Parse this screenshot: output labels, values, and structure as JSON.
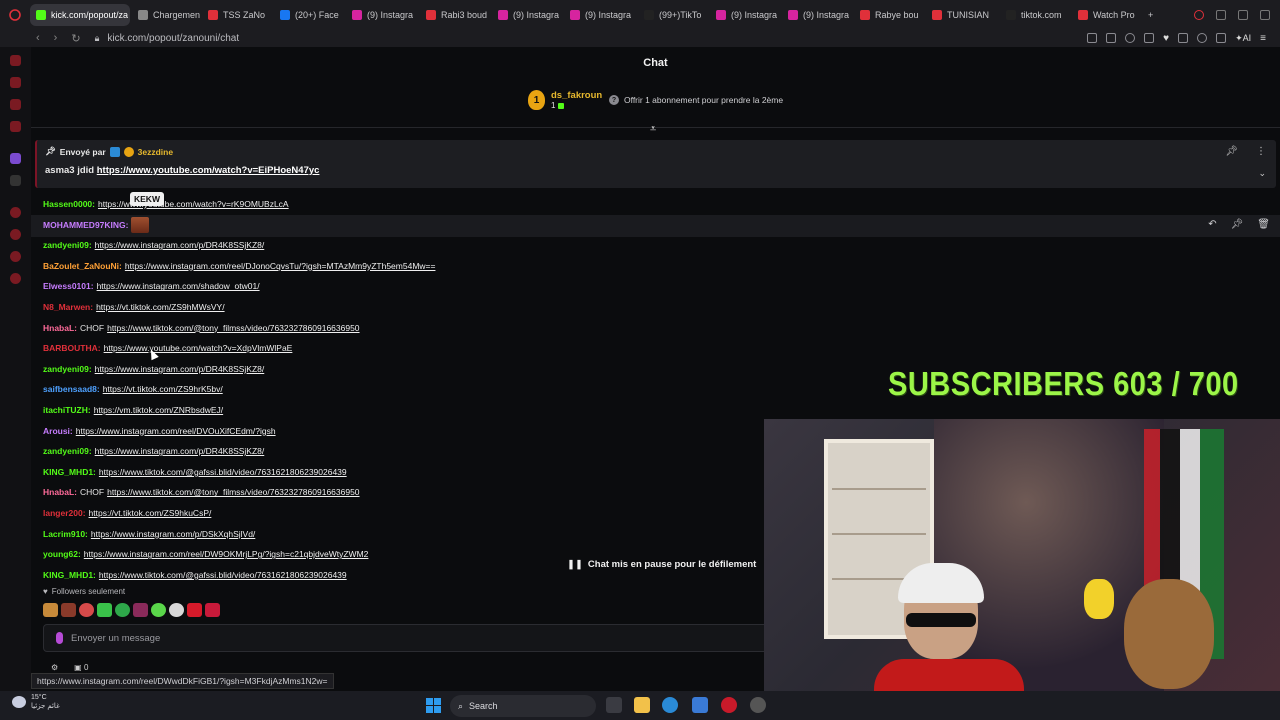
{
  "browser": {
    "tabs": [
      {
        "label": "kick.com/popout/za",
        "color": "#53fc18",
        "active": true
      },
      {
        "label": "Chargemen",
        "color": "#888888"
      },
      {
        "label": "TSS ZaNo",
        "color": "#e0303a"
      },
      {
        "label": "(20+) Face",
        "color": "#1877f2"
      },
      {
        "label": "(9) Instagra",
        "color": "#d6249f"
      },
      {
        "label": "Rabi3 boud",
        "color": "#e0303a"
      },
      {
        "label": "(9) Instagra",
        "color": "#d6249f"
      },
      {
        "label": "(9) Instagra",
        "color": "#d6249f"
      },
      {
        "label": "(99+)TikTo",
        "color": "#222222"
      },
      {
        "label": "(9) Instagra",
        "color": "#d6249f"
      },
      {
        "label": "(9) Instagra",
        "color": "#d6249f"
      },
      {
        "label": "Rabye bou",
        "color": "#e0303a"
      },
      {
        "label": "TUNISIAN",
        "color": "#e0303a"
      },
      {
        "label": "tiktok.com",
        "color": "#222222"
      },
      {
        "label": "Watch Pro",
        "color": "#e0303a"
      }
    ],
    "new_tab": "+",
    "address": "kick.com/popout/zanouni/chat",
    "status_url": "https://www.instagram.com/reel/DWwdDkFiGB1/?igsh=M3FkdjAzMms1N2w="
  },
  "chat": {
    "title": "Chat",
    "leaderboard": {
      "rank": "1",
      "name": "ds_fakroun",
      "count": "1",
      "help_text": "Offrir 1 abonnement pour prendre la 2ème"
    },
    "pinned": {
      "sent_by_label": "Envoyé par",
      "sent_by_user": "3ezzdine",
      "message_prefix": "asma3 jdid",
      "message_link": "https://www.youtube.com/watch?v=EiPHoeN47yc"
    },
    "tooltip": "KEKW",
    "messages": [
      {
        "user": "Hassen0000:",
        "color": "#53fc18",
        "link": "https://www.youtube.com/watch?v=rK9OMUBzLcA"
      },
      {
        "user": "MOHAMMED97KING:",
        "color": "#c77dff",
        "emote": true
      },
      {
        "user": "zandyeni09:",
        "color": "#53fc18",
        "link": "https://www.instagram.com/p/DR4K8SSjKZ8/"
      },
      {
        "user": "BaZoulet_ZaNouNi:",
        "color": "#ffa136",
        "link": "https://www.instagram.com/reel/DJonoCqvsTu/?igsh=MTAzMm9yZTh5em54Mw=="
      },
      {
        "user": "Elwess0101:",
        "color": "#c77dff",
        "link": "https://www.instagram.com/shadow_otw01/"
      },
      {
        "user": "N8_Marwen:",
        "color": "#e0303a",
        "link": "https://vt.tiktok.com/ZS9hMWsVY/"
      },
      {
        "user": "HnabaL:",
        "color": "#ff6b9a",
        "text": "CHOF",
        "link": "https://www.tiktok.com/@tony_filmss/video/7632327860916636950"
      },
      {
        "user": "BARBOUTHA:",
        "color": "#e0303a",
        "link": "https://www.youtube.com/watch?v=XdpVlmWlPaE"
      },
      {
        "user": "zandyeni09:",
        "color": "#53fc18",
        "link": "https://www.instagram.com/p/DR4K8SSjKZ8/"
      },
      {
        "user": "saifbensaad8:",
        "color": "#4ea1ff",
        "link": "https://vt.tiktok.com/ZS9hrK5bv/"
      },
      {
        "user": "itachiTUZH:",
        "color": "#53fc18",
        "link": "https://vm.tiktok.com/ZNRbsdwEJ/"
      },
      {
        "user": "Arousi:",
        "color": "#c77dff",
        "link": "https://www.instagram.com/reel/DVOuXifCEdm/?igsh"
      },
      {
        "user": "zandyeni09:",
        "color": "#53fc18",
        "link": "https://www.instagram.com/p/DR4K8SSjKZ8/"
      },
      {
        "user": "KING_MHD1:",
        "color": "#53fc18",
        "link": "https://www.tiktok.com/@gafssi.blid/video/7631621806239026439"
      },
      {
        "user": "HnabaL:",
        "color": "#ff6b9a",
        "text": "CHOF",
        "link": "https://www.tiktok.com/@tony_filmss/video/7632327860916636950"
      },
      {
        "user": "langer200:",
        "color": "#e0303a",
        "link": "https://vt.tiktok.com/ZS9hkuCsP/"
      },
      {
        "user": "Lacrim910:",
        "color": "#53fc18",
        "link": "https://www.instagram.com/p/DSkXqhSjlVd/"
      },
      {
        "user": "young62:",
        "color": "#53fc18",
        "link": "https://www.instagram.com/reel/DW9OKMrjLPg/?igsh=c21qbjdveWtyZWM2"
      },
      {
        "user": "KING_MHD1:",
        "color": "#53fc18",
        "link": "https://www.tiktok.com/@gafssi.blid/video/7631621806239026439"
      }
    ],
    "paused_label": "Chat mis en pause pour le défilement",
    "followers_only": "Followers seulement",
    "input_placeholder": "Envoyer un message",
    "bottom_count": "0"
  },
  "overlay": {
    "subscribers_text": "SUBSCRIBERS 603 / 700"
  },
  "taskbar": {
    "temperature": "15°C",
    "weather_desc": "غائم جزئيا",
    "search_label": "Search"
  },
  "colors": {
    "kick_green": "#53fc18",
    "subs_green": "#9cf548",
    "pinned_border": "#7c1426"
  }
}
